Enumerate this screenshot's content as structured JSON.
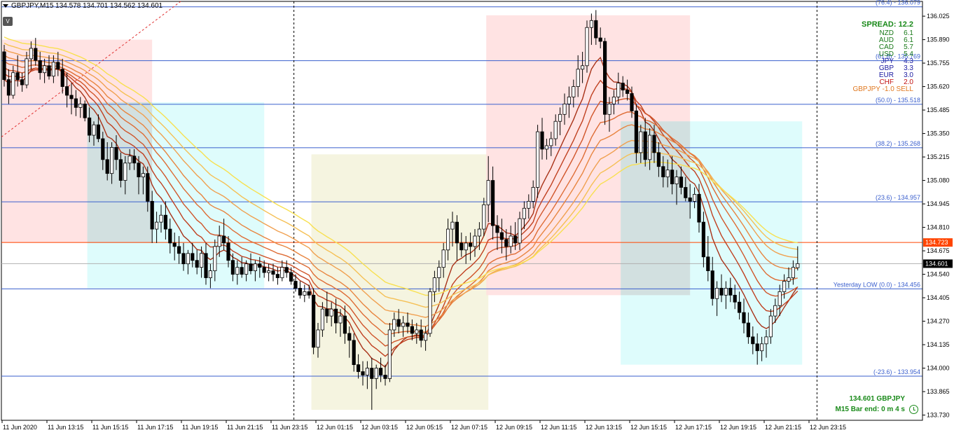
{
  "header": {
    "symbol_line": "GBPJPY,M15  134.578 134.701 134.562 134.601"
  },
  "toolbar": {
    "v_label": "V"
  },
  "spread_panel": {
    "title": "SPREAD: 12.2",
    "currencies": [
      {
        "code": "NZD",
        "value": "6.1",
        "color": "#1a7a1a"
      },
      {
        "code": "AUD",
        "value": "6.1",
        "color": "#1a7a1a"
      },
      {
        "code": "CAD",
        "value": "5.7",
        "color": "#1a7a1a"
      },
      {
        "code": "USD",
        "value": "5.4",
        "color": "#1a7a1a"
      },
      {
        "code": "JPY",
        "value": "4.3",
        "color": "#1a1aa0"
      },
      {
        "code": "GBP",
        "value": "3.3",
        "color": "#1a1aa0"
      },
      {
        "code": "EUR",
        "value": "3.0",
        "color": "#1a1aa0"
      },
      {
        "code": "CHF",
        "value": "2.0",
        "color": "#c01010"
      }
    ],
    "signal": "GBPJPY -1.0 SELL",
    "signal_color": "#e07820"
  },
  "bottom_info": {
    "price_line": "134.601  GBPJPY",
    "bar_end": "M15 Bar end: 0 m 4 s"
  },
  "chart_data": {
    "type": "candlestick",
    "title": "GBPJPY,M15",
    "symbol": "GBPJPY",
    "timeframe": "M15",
    "ohlc_last": {
      "open": 134.578,
      "high": 134.701,
      "low": 134.562,
      "close": 134.601
    },
    "y_range": [
      133.7,
      136.11
    ],
    "y_ticks": [
      "136.025",
      "135.890",
      "135.755",
      "135.620",
      "135.485",
      "135.350",
      "135.215",
      "135.080",
      "134.945",
      "134.810",
      "134.675",
      "134.540",
      "134.405",
      "134.270",
      "134.135",
      "134.000",
      "133.865",
      "133.730"
    ],
    "x_ticks": [
      "11 Jun 2020",
      "11 Jun 13:15",
      "11 Jun 15:15",
      "11 Jun 17:15",
      "11 Jun 19:15",
      "11 Jun 21:15",
      "11 Jun 23:15",
      "12 Jun 01:15",
      "12 Jun 03:15",
      "12 Jun 05:15",
      "12 Jun 07:15",
      "12 Jun 09:15",
      "12 Jun 11:15",
      "12 Jun 13:15",
      "12 Jun 15:15",
      "12 Jun 17:15",
      "12 Jun 19:15",
      "12 Jun 21:15",
      "12 Jun 23:15"
    ],
    "fib_levels": [
      {
        "label": "(76.4)  -  136.079",
        "price": 136.079
      },
      {
        "label": "(61.8)  -  135.769",
        "price": 135.769
      },
      {
        "label": "(50.0)  -  135.518",
        "price": 135.518
      },
      {
        "label": "(38.2)  -  135.268",
        "price": 135.268
      },
      {
        "label": "(23.6)  -  134.957",
        "price": 134.957
      },
      {
        "label": "Yesterday LOW (0.0)  -  134.456",
        "price": 134.456
      },
      {
        "label": "(-23.6)  -  133.954",
        "price": 133.954
      }
    ],
    "price_markers": [
      {
        "label": "134.723",
        "price": 134.723,
        "color": "#ff4500"
      },
      {
        "label": "134.601",
        "price": 134.601,
        "color": "#000000"
      }
    ],
    "zones": [
      {
        "from_bar": 0,
        "to_bar": 33,
        "top": 135.89,
        "bottom": 134.72,
        "color": "#ffdede"
      },
      {
        "from_bar": 19,
        "to_bar": 58,
        "top": 135.53,
        "bottom": 134.46,
        "color": "#d8fbfc"
      },
      {
        "from_bar": 69,
        "to_bar": 108,
        "top": 135.23,
        "bottom": 133.76,
        "color": "#f3f2da"
      },
      {
        "from_bar": 108,
        "to_bar": 153,
        "top": 136.03,
        "bottom": 134.42,
        "color": "#ffdede"
      },
      {
        "from_bar": 138,
        "to_bar": 178,
        "top": 135.42,
        "bottom": 134.02,
        "color": "#d8fbfc"
      }
    ],
    "session_separators": [
      "11 Jun 23:15",
      "12 Jun 23:15"
    ],
    "candles": [
      [
        135.82,
        135.86,
        135.62,
        135.66
      ],
      [
        135.66,
        135.72,
        135.52,
        135.57
      ],
      [
        135.57,
        135.74,
        135.55,
        135.7
      ],
      [
        135.7,
        135.8,
        135.62,
        135.66
      ],
      [
        135.66,
        135.7,
        135.59,
        135.63
      ],
      [
        135.63,
        135.82,
        135.61,
        135.78
      ],
      [
        135.78,
        135.88,
        135.72,
        135.84
      ],
      [
        135.84,
        135.9,
        135.74,
        135.77
      ],
      [
        135.77,
        135.82,
        135.66,
        135.7
      ],
      [
        135.7,
        135.78,
        135.64,
        135.74
      ],
      [
        135.74,
        135.8,
        135.66,
        135.68
      ],
      [
        135.68,
        135.8,
        135.64,
        135.76
      ],
      [
        135.76,
        135.82,
        135.68,
        135.72
      ],
      [
        135.72,
        135.78,
        135.58,
        135.62
      ],
      [
        135.62,
        135.7,
        135.5,
        135.57
      ],
      [
        135.57,
        135.64,
        135.46,
        135.55
      ],
      [
        135.55,
        135.6,
        135.45,
        135.5
      ],
      [
        135.5,
        135.56,
        135.44,
        135.52
      ],
      [
        135.52,
        135.54,
        135.42,
        135.44
      ],
      [
        135.44,
        135.5,
        135.3,
        135.34
      ],
      [
        135.34,
        135.42,
        135.28,
        135.4
      ],
      [
        135.4,
        135.46,
        135.3,
        135.32
      ],
      [
        135.32,
        135.36,
        135.14,
        135.2
      ],
      [
        135.2,
        135.3,
        135.08,
        135.12
      ],
      [
        135.12,
        135.3,
        135.06,
        135.27
      ],
      [
        135.27,
        135.34,
        135.14,
        135.2
      ],
      [
        135.2,
        135.24,
        135.04,
        135.08
      ],
      [
        135.08,
        135.22,
        135.0,
        135.18
      ],
      [
        135.18,
        135.26,
        135.14,
        135.22
      ],
      [
        135.22,
        135.26,
        135.14,
        135.18
      ],
      [
        135.18,
        135.22,
        135.0,
        135.1
      ],
      [
        135.1,
        135.16,
        135.0,
        135.12
      ],
      [
        135.12,
        135.16,
        134.9,
        134.96
      ],
      [
        134.96,
        135.02,
        134.72,
        134.8
      ],
      [
        134.8,
        134.9,
        134.72,
        134.84
      ],
      [
        134.84,
        134.94,
        134.78,
        134.88
      ],
      [
        134.88,
        134.96,
        134.74,
        134.8
      ],
      [
        134.8,
        134.86,
        134.66,
        134.72
      ],
      [
        134.72,
        134.78,
        134.62,
        134.7
      ],
      [
        134.7,
        134.76,
        134.6,
        134.66
      ],
      [
        134.66,
        134.72,
        134.56,
        134.6
      ],
      [
        134.6,
        134.68,
        134.54,
        134.66
      ],
      [
        134.66,
        134.72,
        134.58,
        134.62
      ],
      [
        134.62,
        134.68,
        134.54,
        134.58
      ],
      [
        134.58,
        134.7,
        134.52,
        134.66
      ],
      [
        134.66,
        134.72,
        134.48,
        134.52
      ],
      [
        134.52,
        134.6,
        134.46,
        134.56
      ],
      [
        134.56,
        134.74,
        134.5,
        134.7
      ],
      [
        134.7,
        134.82,
        134.64,
        134.76
      ],
      [
        134.76,
        134.86,
        134.68,
        134.72
      ],
      [
        134.72,
        134.76,
        134.58,
        134.62
      ],
      [
        134.62,
        134.66,
        134.5,
        134.54
      ],
      [
        134.54,
        134.62,
        134.48,
        134.58
      ],
      [
        134.58,
        134.64,
        134.52,
        134.54
      ],
      [
        134.54,
        134.62,
        134.5,
        134.6
      ],
      [
        134.6,
        134.66,
        134.54,
        134.56
      ],
      [
        134.56,
        134.62,
        134.5,
        134.6
      ],
      [
        134.6,
        134.64,
        134.52,
        134.58
      ],
      [
        134.58,
        134.62,
        134.52,
        134.55
      ],
      [
        134.55,
        134.6,
        134.5,
        134.56
      ],
      [
        134.56,
        134.6,
        134.5,
        134.54
      ],
      [
        134.54,
        134.58,
        134.48,
        134.52
      ],
      [
        134.52,
        134.62,
        134.5,
        134.58
      ],
      [
        134.58,
        134.62,
        134.52,
        134.55
      ],
      [
        134.55,
        134.58,
        134.48,
        134.5
      ],
      [
        134.5,
        134.54,
        134.44,
        134.46
      ],
      [
        134.46,
        134.5,
        134.4,
        134.42
      ],
      [
        134.42,
        134.48,
        134.38,
        134.44
      ],
      [
        134.44,
        134.48,
        134.4,
        134.42
      ],
      [
        134.42,
        134.46,
        134.08,
        134.12
      ],
      [
        134.12,
        134.26,
        134.06,
        134.22
      ],
      [
        134.22,
        134.38,
        134.18,
        134.34
      ],
      [
        134.34,
        134.44,
        134.26,
        134.3
      ],
      [
        134.3,
        134.38,
        134.24,
        134.34
      ],
      [
        134.34,
        134.4,
        134.2,
        134.26
      ],
      [
        134.26,
        134.34,
        134.18,
        134.3
      ],
      [
        134.3,
        134.36,
        134.14,
        134.2
      ],
      [
        134.2,
        134.24,
        134.06,
        134.16
      ],
      [
        134.16,
        134.2,
        133.98,
        134.02
      ],
      [
        134.02,
        134.08,
        133.94,
        133.98
      ],
      [
        133.98,
        134.04,
        133.9,
        133.96
      ],
      [
        133.96,
        134.04,
        133.88,
        134.0
      ],
      [
        134.0,
        134.06,
        133.76,
        133.94
      ],
      [
        133.94,
        134.02,
        133.88,
        134.0
      ],
      [
        134.0,
        134.06,
        133.92,
        133.96
      ],
      [
        133.96,
        134.02,
        133.9,
        133.94
      ],
      [
        133.94,
        134.26,
        133.92,
        134.22
      ],
      [
        134.22,
        134.32,
        134.18,
        134.28
      ],
      [
        134.28,
        134.34,
        134.2,
        134.24
      ],
      [
        134.24,
        134.3,
        134.18,
        134.26
      ],
      [
        134.26,
        134.32,
        134.2,
        134.24
      ],
      [
        134.24,
        134.28,
        134.16,
        134.2
      ],
      [
        134.2,
        134.26,
        134.14,
        134.22
      ],
      [
        134.22,
        134.28,
        134.12,
        134.16
      ],
      [
        134.16,
        134.24,
        134.1,
        134.2
      ],
      [
        134.2,
        134.46,
        134.18,
        134.44
      ],
      [
        134.44,
        134.56,
        134.38,
        134.52
      ],
      [
        134.52,
        134.62,
        134.44,
        134.58
      ],
      [
        134.58,
        134.72,
        134.52,
        134.68
      ],
      [
        134.68,
        134.86,
        134.62,
        134.8
      ],
      [
        134.8,
        134.9,
        134.7,
        134.84
      ],
      [
        134.84,
        134.88,
        134.62,
        134.72
      ],
      [
        134.72,
        134.78,
        134.64,
        134.68
      ],
      [
        134.68,
        134.76,
        134.6,
        134.72
      ],
      [
        134.72,
        134.78,
        134.62,
        134.7
      ],
      [
        134.7,
        134.8,
        134.64,
        134.76
      ],
      [
        134.76,
        134.84,
        134.68,
        134.8
      ],
      [
        134.8,
        134.98,
        134.76,
        134.94
      ],
      [
        134.94,
        135.22,
        134.84,
        135.08
      ],
      [
        135.08,
        135.16,
        134.74,
        134.82
      ],
      [
        134.82,
        134.88,
        134.68,
        134.78
      ],
      [
        134.78,
        134.86,
        134.66,
        134.74
      ],
      [
        134.74,
        134.8,
        134.62,
        134.7
      ],
      [
        134.7,
        134.82,
        134.66,
        134.76
      ],
      [
        134.76,
        134.84,
        134.68,
        134.72
      ],
      [
        134.72,
        134.9,
        134.68,
        134.86
      ],
      [
        134.86,
        134.96,
        134.8,
        134.92
      ],
      [
        134.92,
        135.0,
        134.86,
        134.96
      ],
      [
        134.96,
        135.08,
        134.92,
        135.04
      ],
      [
        135.04,
        135.4,
        134.98,
        135.36
      ],
      [
        135.36,
        135.44,
        135.2,
        135.26
      ],
      [
        135.26,
        135.32,
        135.2,
        135.28
      ],
      [
        135.28,
        135.36,
        135.22,
        135.32
      ],
      [
        135.32,
        135.46,
        135.28,
        135.42
      ],
      [
        135.42,
        135.5,
        135.34,
        135.46
      ],
      [
        135.46,
        135.58,
        135.4,
        135.52
      ],
      [
        135.52,
        135.62,
        135.44,
        135.56
      ],
      [
        135.56,
        135.66,
        135.5,
        135.62
      ],
      [
        135.62,
        135.8,
        135.56,
        135.72
      ],
      [
        135.72,
        135.82,
        135.64,
        135.74
      ],
      [
        135.74,
        136.0,
        135.7,
        135.96
      ],
      [
        135.96,
        136.04,
        135.86,
        136.0
      ],
      [
        136.0,
        136.06,
        135.86,
        135.9
      ],
      [
        135.9,
        135.96,
        135.84,
        135.88
      ],
      [
        135.88,
        135.9,
        135.4,
        135.46
      ],
      [
        135.46,
        135.56,
        135.36,
        135.52
      ],
      [
        135.52,
        135.6,
        135.46,
        135.56
      ],
      [
        135.56,
        135.7,
        135.52,
        135.64
      ],
      [
        135.64,
        135.68,
        135.56,
        135.6
      ],
      [
        135.6,
        135.66,
        135.54,
        135.58
      ],
      [
        135.58,
        135.62,
        135.44,
        135.48
      ],
      [
        135.48,
        135.52,
        135.18,
        135.24
      ],
      [
        135.24,
        135.4,
        135.18,
        135.36
      ],
      [
        135.36,
        135.44,
        135.16,
        135.2
      ],
      [
        135.2,
        135.38,
        135.14,
        135.34
      ],
      [
        135.34,
        135.4,
        135.18,
        135.24
      ],
      [
        135.24,
        135.3,
        135.1,
        135.16
      ],
      [
        135.16,
        135.22,
        135.04,
        135.1
      ],
      [
        135.1,
        135.2,
        135.04,
        135.14
      ],
      [
        135.14,
        135.22,
        135.0,
        135.06
      ],
      [
        135.06,
        135.14,
        134.94,
        135.1
      ],
      [
        135.1,
        135.16,
        135.0,
        135.04
      ],
      [
        135.04,
        135.1,
        134.96,
        134.98
      ],
      [
        134.98,
        135.06,
        134.86,
        134.96
      ],
      [
        134.96,
        135.04,
        134.92,
        135.0
      ],
      [
        135.0,
        135.06,
        134.78,
        134.84
      ],
      [
        134.84,
        134.9,
        134.58,
        134.64
      ],
      [
        134.64,
        134.76,
        134.5,
        134.56
      ],
      [
        134.56,
        134.64,
        134.36,
        134.4
      ],
      [
        134.4,
        134.5,
        134.3,
        134.46
      ],
      [
        134.46,
        134.54,
        134.38,
        134.42
      ],
      [
        134.42,
        134.5,
        134.34,
        134.46
      ],
      [
        134.46,
        134.52,
        134.38,
        134.42
      ],
      [
        134.42,
        134.48,
        134.34,
        134.38
      ],
      [
        134.38,
        134.44,
        134.28,
        134.32
      ],
      [
        134.32,
        134.4,
        134.2,
        134.26
      ],
      [
        134.26,
        134.32,
        134.14,
        134.18
      ],
      [
        134.18,
        134.24,
        134.08,
        134.14
      ],
      [
        134.14,
        134.2,
        134.02,
        134.1
      ],
      [
        134.1,
        134.18,
        134.04,
        134.14
      ],
      [
        134.14,
        134.22,
        134.06,
        134.18
      ],
      [
        134.18,
        134.34,
        134.14,
        134.3
      ],
      [
        134.3,
        134.4,
        134.26,
        134.36
      ],
      [
        134.36,
        134.48,
        134.3,
        134.44
      ],
      [
        134.44,
        134.54,
        134.4,
        134.5
      ],
      [
        134.5,
        134.58,
        134.46,
        134.52
      ],
      [
        134.52,
        134.62,
        134.48,
        134.58
      ],
      [
        134.578,
        134.701,
        134.562,
        134.601
      ]
    ]
  }
}
